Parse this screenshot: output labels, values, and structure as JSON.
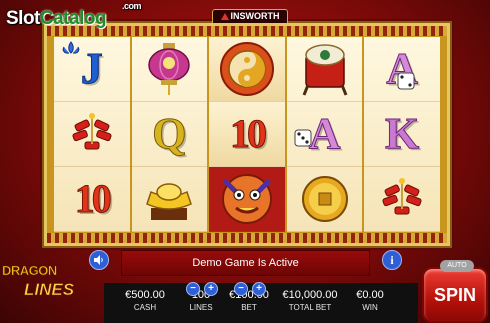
{
  "watermark": {
    "slot": "Slot",
    "catalog": "Catalog",
    "dotcom": ".com"
  },
  "provider": "INSWORTH",
  "game_logo": {
    "line1": "DRAGON",
    "line2": "LINES"
  },
  "reels": [
    [
      "J",
      "lantern",
      "firecrackers",
      "10"
    ],
    [
      "lantern-2",
      "Q",
      "gold-ingot"
    ],
    [
      "yin-yang",
      "10",
      "dragon"
    ],
    [
      "drum",
      "A",
      "coin"
    ],
    [
      "A",
      "K",
      "firecrackers"
    ]
  ],
  "cards": {
    "r0c0": "J",
    "r0c3": "10",
    "r1c1": "Q",
    "r2c1": "10",
    "r3c1": "A",
    "r4c0": "A",
    "r4c1": "K"
  },
  "message": "Demo Game Is Active",
  "stats": {
    "cash": {
      "value": "€500.00",
      "label": "CASH"
    },
    "lines": {
      "value": "100",
      "label": "LINES"
    },
    "bet": {
      "value": "€100.00",
      "label": "BET"
    },
    "total_bet": {
      "value": "€10,000.00",
      "label": "TOTAL BET"
    },
    "win": {
      "value": "€0.00",
      "label": "WIN"
    }
  },
  "controls": {
    "minus": "−",
    "plus": "+",
    "auto": "AUTO",
    "spin": "SPIN",
    "info": "i"
  },
  "colors": {
    "accent": "#b31511",
    "gold": "#c8951f",
    "button_blue": "#2e5fd6",
    "spin_red": "#d8241b"
  }
}
